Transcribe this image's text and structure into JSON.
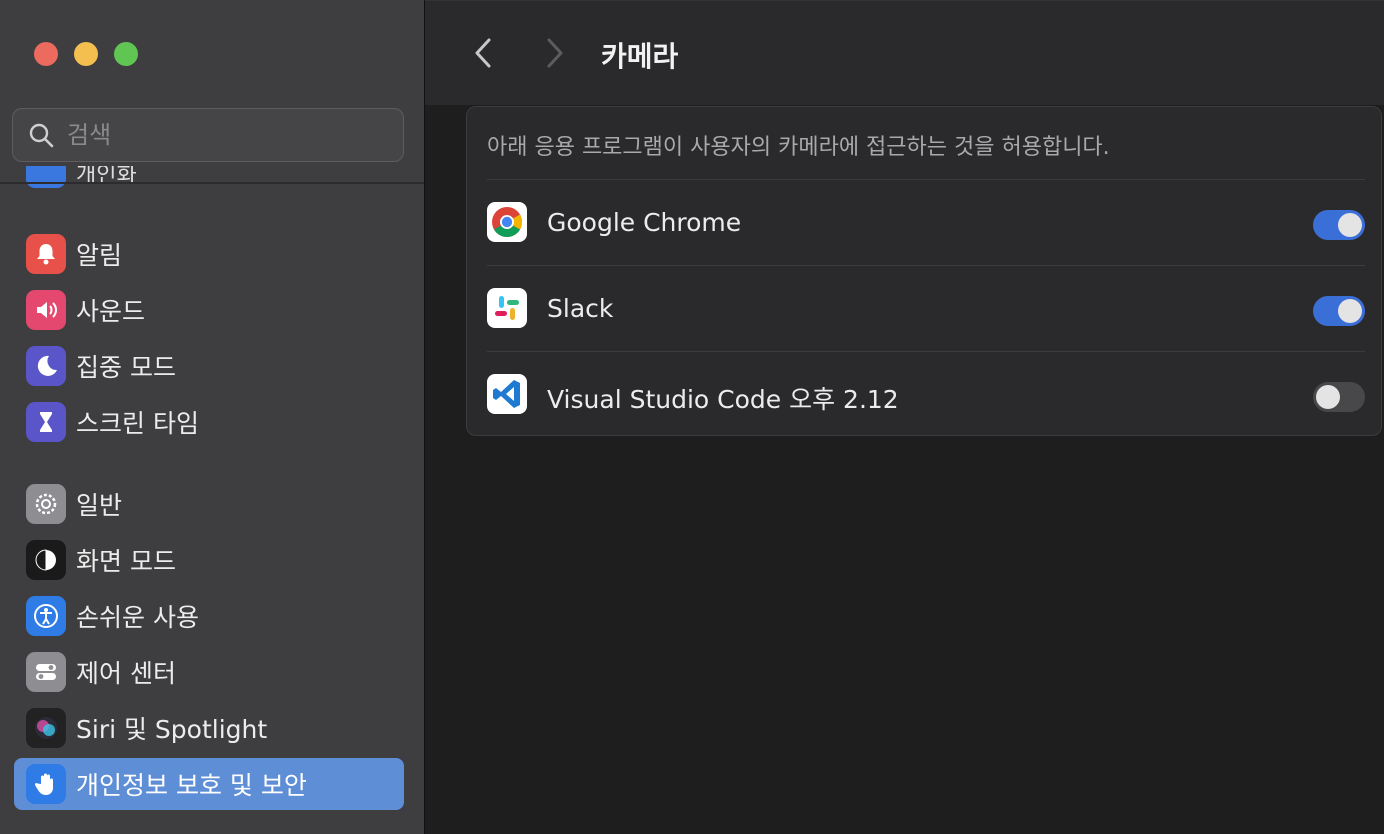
{
  "window": {
    "controls": [
      "close",
      "minimize",
      "maximize"
    ]
  },
  "search": {
    "placeholder": "검색"
  },
  "sidebar": {
    "partial_label": "개인화",
    "groups": [
      [
        {
          "label": "알림",
          "icon": "bell-icon",
          "color": "#e8504a"
        },
        {
          "label": "사운드",
          "icon": "speaker-icon",
          "color": "#e5486e"
        },
        {
          "label": "집중 모드",
          "icon": "moon-icon",
          "color": "#5a56c9"
        },
        {
          "label": "스크린 타임",
          "icon": "hourglass-icon",
          "color": "#5a56c9"
        }
      ],
      [
        {
          "label": "일반",
          "icon": "gear-icon",
          "color": "#8e8e92"
        },
        {
          "label": "화면 모드",
          "icon": "appearance-icon",
          "color": "#1a1a1a"
        },
        {
          "label": "손쉬운 사용",
          "icon": "accessibility-icon",
          "color": "#2f7ce6"
        },
        {
          "label": "제어 센터",
          "icon": "control-center-icon",
          "color": "#8e8e92"
        },
        {
          "label": "Siri 및 Spotlight",
          "icon": "siri-icon",
          "color": "#222"
        },
        {
          "label": "개인정보 보호 및 보안",
          "icon": "hand-icon",
          "color": "#2f7ce6",
          "selected": true
        }
      ]
    ]
  },
  "main": {
    "title": "카메라",
    "description": "아래 응용 프로그램이 사용자의 카메라에 접근하는 것을 허용합니다.",
    "apps": [
      {
        "name": "Google Chrome",
        "icon": "chrome-icon",
        "enabled": true
      },
      {
        "name": "Slack",
        "icon": "slack-icon",
        "enabled": true
      },
      {
        "name": "Visual Studio Code 오후 2.12",
        "icon": "vscode-icon",
        "enabled": false
      }
    ]
  },
  "colors": {
    "accent": "#3b6fd8",
    "selected_row": "#5e8fd6"
  }
}
